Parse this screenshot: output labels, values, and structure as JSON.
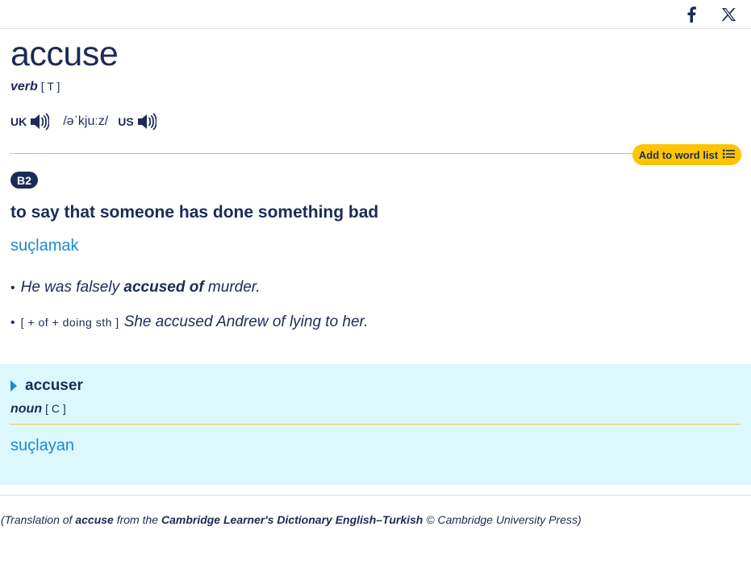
{
  "social": {
    "facebook_icon": "facebook-icon",
    "x_icon": "x-twitter-icon"
  },
  "entry": {
    "headword": "accuse",
    "pos": "verb",
    "grammar": "[ T ]",
    "uk_label": "UK",
    "ipa": "/əˈkjuːz/",
    "us_label": "US",
    "add_to_word_list": "Add to word list",
    "level": "B2",
    "definition": "to say that someone has done something bad",
    "translation": "suçlamak",
    "examples": [
      {
        "bullet": "•",
        "before": "He was falsely ",
        "bold": "accused of",
        "after": " murder."
      },
      {
        "bullet": "•",
        "grammar_code": "[ + of + doing sth ]",
        "text": "She accused Andrew of lying to her."
      }
    ]
  },
  "derived": {
    "word": "accuser",
    "pos": "noun",
    "grammar": "[ C ]",
    "translation": "suçlayan"
  },
  "credit": {
    "open": "(Translation of ",
    "word": "accuse",
    "from": " from the ",
    "source": "Cambridge Learner's Dictionary English–Turkish",
    "rest": " © Cambridge University Press)"
  },
  "colors": {
    "navy": "#1d2a57",
    "link_blue": "#1a8ad4",
    "yellow": "#fec400",
    "derived_bg": "#dcf8fd"
  }
}
